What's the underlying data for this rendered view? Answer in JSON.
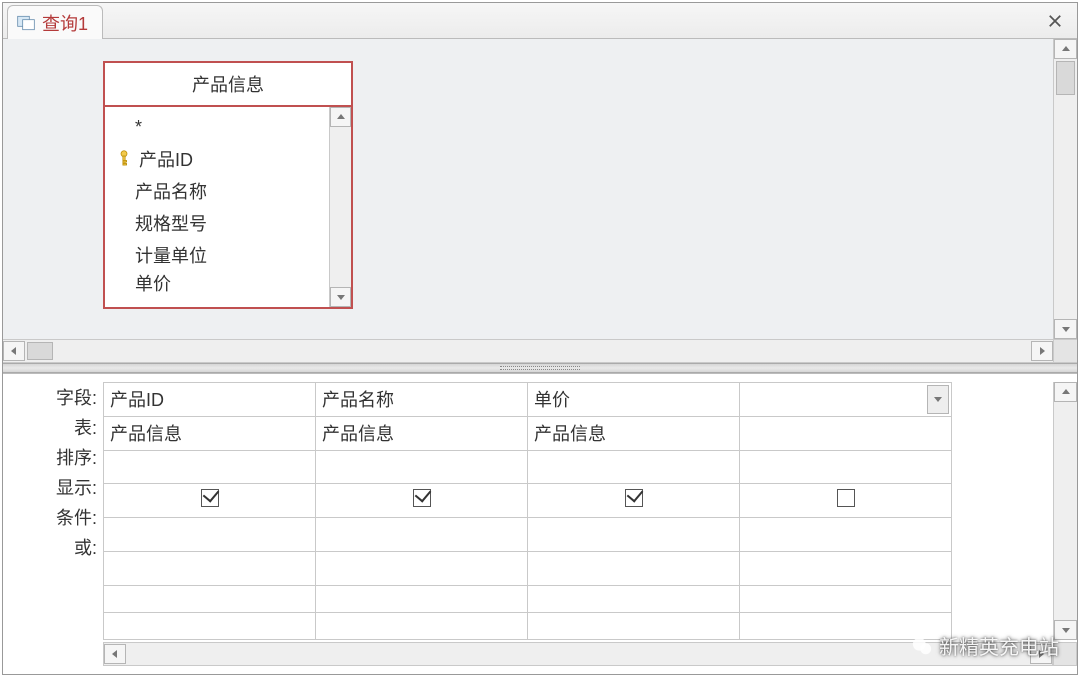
{
  "tab": {
    "title": "查询1"
  },
  "table_box": {
    "title": "产品信息",
    "fields": [
      {
        "name": "*",
        "pk": false
      },
      {
        "name": "产品ID",
        "pk": true
      },
      {
        "name": "产品名称",
        "pk": false
      },
      {
        "name": "规格型号",
        "pk": false
      },
      {
        "name": "计量单位",
        "pk": false
      },
      {
        "name": "单价",
        "pk": false
      }
    ]
  },
  "grid": {
    "row_labels": {
      "field": "字段:",
      "table": "表:",
      "sort": "排序:",
      "show": "显示:",
      "criteria": "条件:",
      "or": "或:"
    },
    "columns": [
      {
        "field": "产品ID",
        "table": "产品信息",
        "sort": "",
        "show": true,
        "criteria": "",
        "or": ""
      },
      {
        "field": "产品名称",
        "table": "产品信息",
        "sort": "",
        "show": true,
        "criteria": "",
        "or": ""
      },
      {
        "field": "单价",
        "table": "产品信息",
        "sort": "",
        "show": true,
        "criteria": "",
        "or": ""
      },
      {
        "field": "",
        "table": "",
        "sort": "",
        "show": false,
        "criteria": "",
        "or": ""
      }
    ]
  },
  "watermark": "新精英充电站"
}
